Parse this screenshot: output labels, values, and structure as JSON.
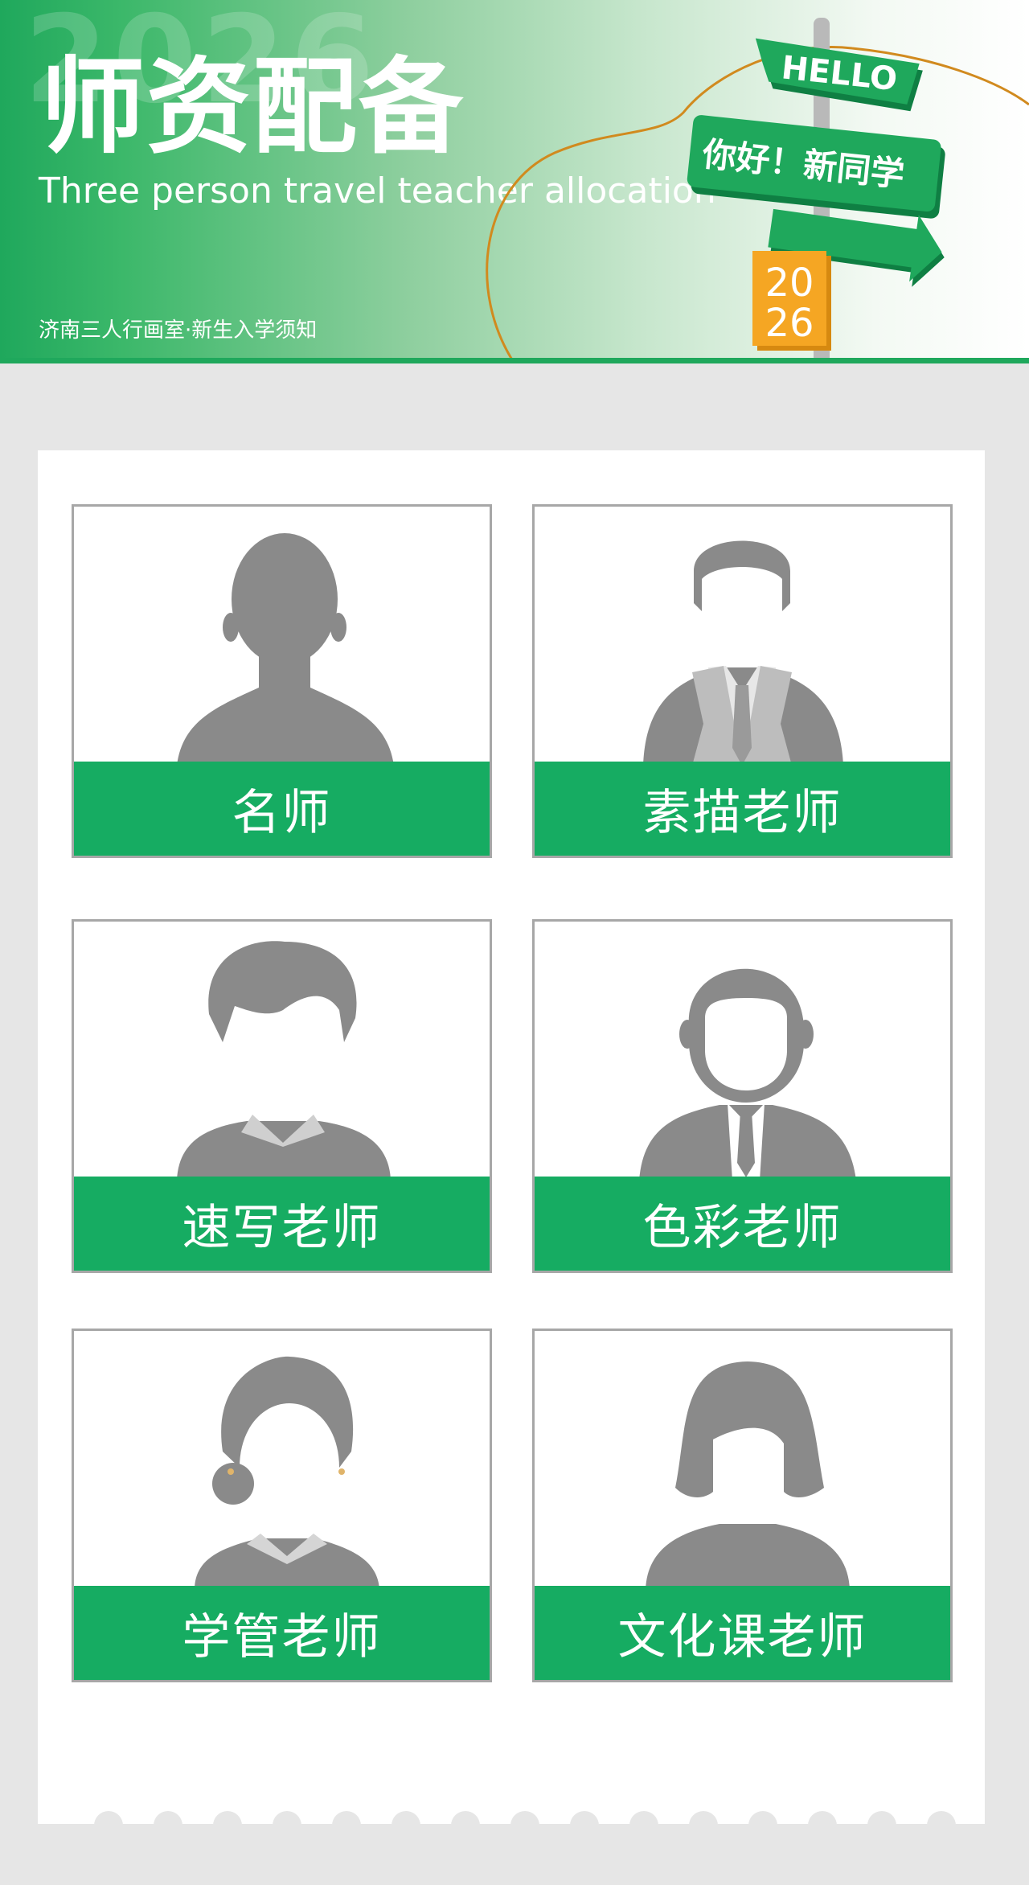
{
  "header": {
    "title": "师资配备",
    "subtitle": "Three person travel teacher allocation",
    "studio_line": "济南三人行画室·新生入学须知",
    "ghost_year": "2026",
    "sign_hello": "HELLO",
    "sign_greeting": "你好！新同学",
    "sign_year_top": "20",
    "sign_year_bottom": "26"
  },
  "colors": {
    "brand_green": "#16ac62",
    "avatar_gray": "#8a8a8a",
    "sign_orange": "#f5a623"
  },
  "teachers": [
    {
      "label": "名师",
      "icon": "male-avatar-icon"
    },
    {
      "label": "素描老师",
      "icon": "male-suit-avatar-icon"
    },
    {
      "label": "速写老师",
      "icon": "male-sweater-avatar-icon"
    },
    {
      "label": "色彩老师",
      "icon": "male-beard-avatar-icon"
    },
    {
      "label": "学管老师",
      "icon": "female-bun-avatar-icon"
    },
    {
      "label": "文化课老师",
      "icon": "female-avatar-icon"
    }
  ]
}
